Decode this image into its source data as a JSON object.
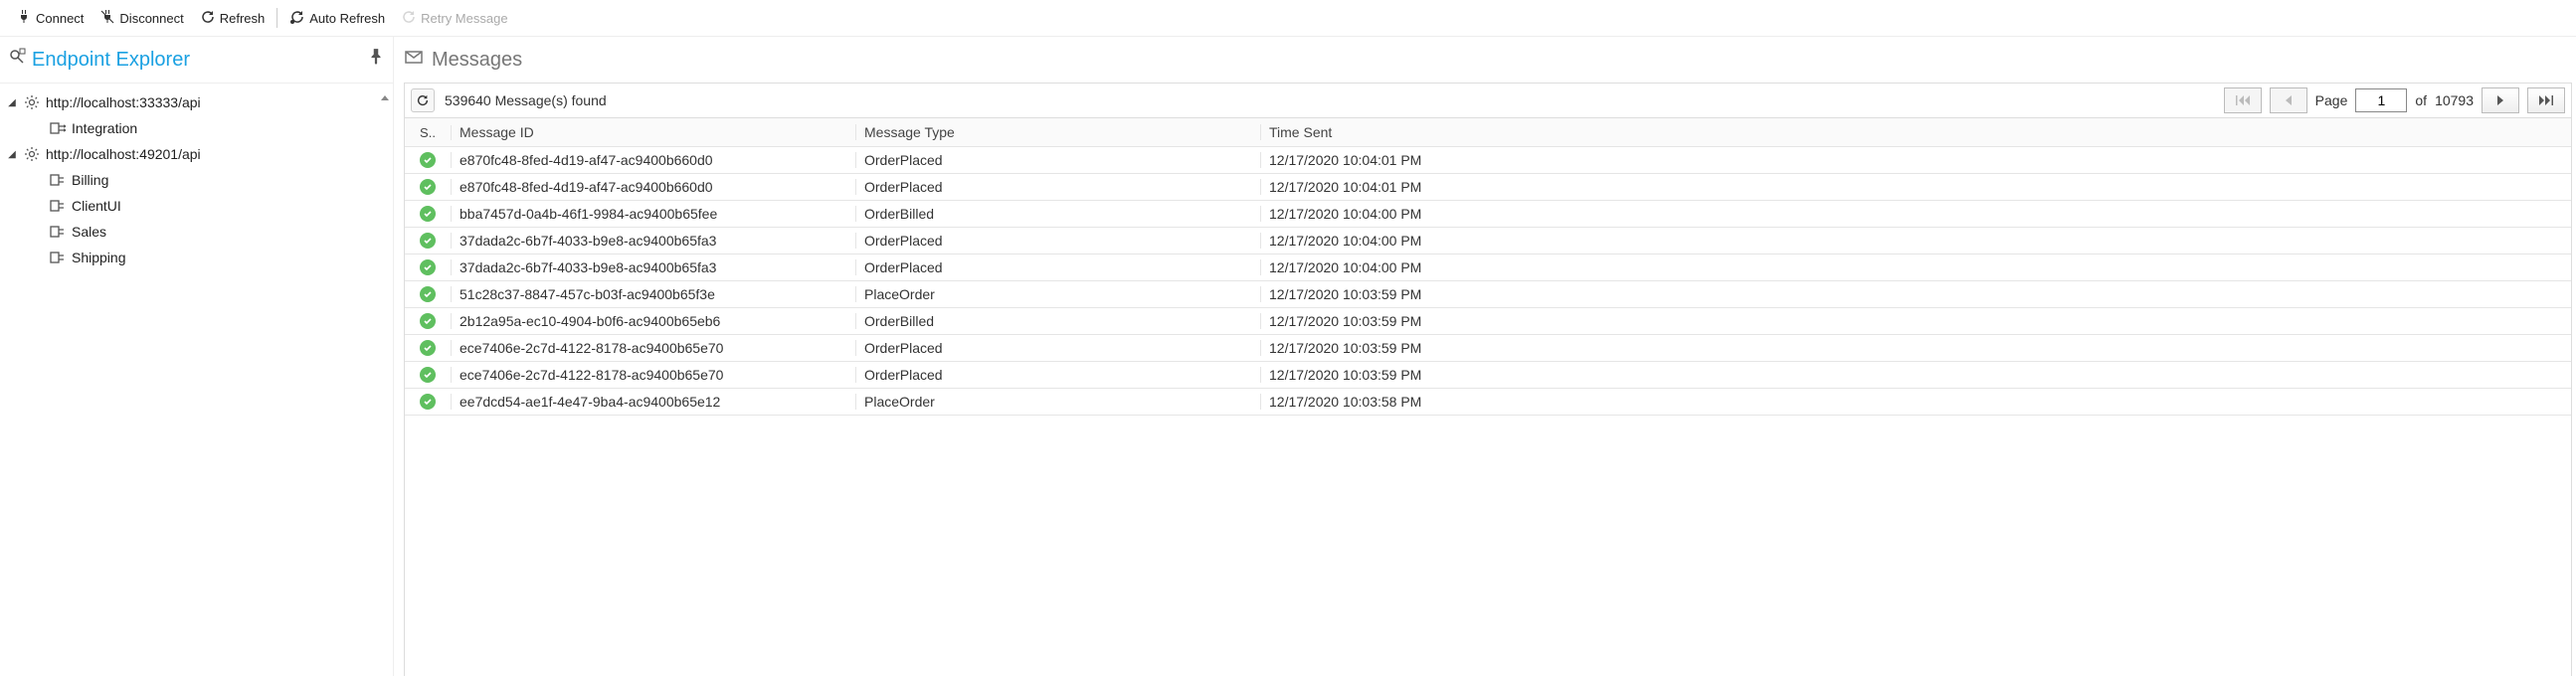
{
  "toolbar": {
    "connect": "Connect",
    "disconnect": "Disconnect",
    "refresh": "Refresh",
    "auto_refresh": "Auto Refresh",
    "retry": "Retry Message"
  },
  "explorer": {
    "title": "Endpoint Explorer",
    "roots": [
      {
        "label": "http://localhost:33333/api",
        "expanded": true,
        "children": [
          {
            "label": "Integration"
          }
        ]
      },
      {
        "label": "http://localhost:49201/api",
        "expanded": true,
        "children": [
          {
            "label": "Billing"
          },
          {
            "label": "ClientUI"
          },
          {
            "label": "Sales"
          },
          {
            "label": "Shipping"
          }
        ]
      }
    ]
  },
  "messages": {
    "title": "Messages",
    "found_count": "539640",
    "found_suffix": "Message(s) found",
    "page_label": "Page",
    "page_current": "1",
    "page_of": "of",
    "page_total": "10793",
    "columns": {
      "status": "S..",
      "id": "Message ID",
      "type": "Message Type",
      "time": "Time Sent"
    },
    "rows": [
      {
        "status": "ok",
        "id": "e870fc48-8fed-4d19-af47-ac9400b660d0",
        "type": "OrderPlaced",
        "time": "12/17/2020 10:04:01 PM"
      },
      {
        "status": "ok",
        "id": "e870fc48-8fed-4d19-af47-ac9400b660d0",
        "type": "OrderPlaced",
        "time": "12/17/2020 10:04:01 PM"
      },
      {
        "status": "ok",
        "id": "bba7457d-0a4b-46f1-9984-ac9400b65fee",
        "type": "OrderBilled",
        "time": "12/17/2020 10:04:00 PM"
      },
      {
        "status": "ok",
        "id": "37dada2c-6b7f-4033-b9e8-ac9400b65fa3",
        "type": "OrderPlaced",
        "time": "12/17/2020 10:04:00 PM"
      },
      {
        "status": "ok",
        "id": "37dada2c-6b7f-4033-b9e8-ac9400b65fa3",
        "type": "OrderPlaced",
        "time": "12/17/2020 10:04:00 PM"
      },
      {
        "status": "ok",
        "id": "51c28c37-8847-457c-b03f-ac9400b65f3e",
        "type": "PlaceOrder",
        "time": "12/17/2020 10:03:59 PM"
      },
      {
        "status": "ok",
        "id": "2b12a95a-ec10-4904-b0f6-ac9400b65eb6",
        "type": "OrderBilled",
        "time": "12/17/2020 10:03:59 PM"
      },
      {
        "status": "ok",
        "id": "ece7406e-2c7d-4122-8178-ac9400b65e70",
        "type": "OrderPlaced",
        "time": "12/17/2020 10:03:59 PM"
      },
      {
        "status": "ok",
        "id": "ece7406e-2c7d-4122-8178-ac9400b65e70",
        "type": "OrderPlaced",
        "time": "12/17/2020 10:03:59 PM"
      },
      {
        "status": "ok",
        "id": "ee7dcd54-ae1f-4e47-9ba4-ac9400b65e12",
        "type": "PlaceOrder",
        "time": "12/17/2020 10:03:58 PM"
      }
    ]
  }
}
